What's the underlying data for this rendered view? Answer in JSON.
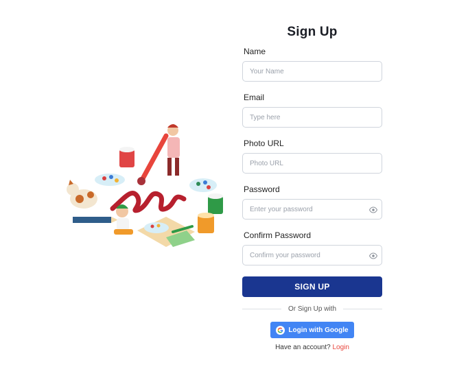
{
  "form": {
    "title": "Sign Up",
    "fields": [
      {
        "label": "Name",
        "placeholder": "Your Name",
        "value": ""
      },
      {
        "label": "Email",
        "placeholder": "Type here",
        "value": ""
      },
      {
        "label": "Photo URL",
        "placeholder": "Photo URL",
        "value": ""
      },
      {
        "label": "Password",
        "placeholder": "Enter your password",
        "value": ""
      },
      {
        "label": "Confirm Password",
        "placeholder": "Confirm your password",
        "value": ""
      }
    ],
    "signup_label": "SIGN UP",
    "divider_text": "Or Sign Up with",
    "google_label": "Login with Google",
    "google_icon": "google-icon",
    "password_toggle_icon": "eye-icon",
    "footer_text": "Have an account?",
    "login_link": "Login"
  },
  "colors": {
    "primary_button": "#1a3690",
    "google_button": "#4285f4",
    "link": "#e8453c"
  }
}
